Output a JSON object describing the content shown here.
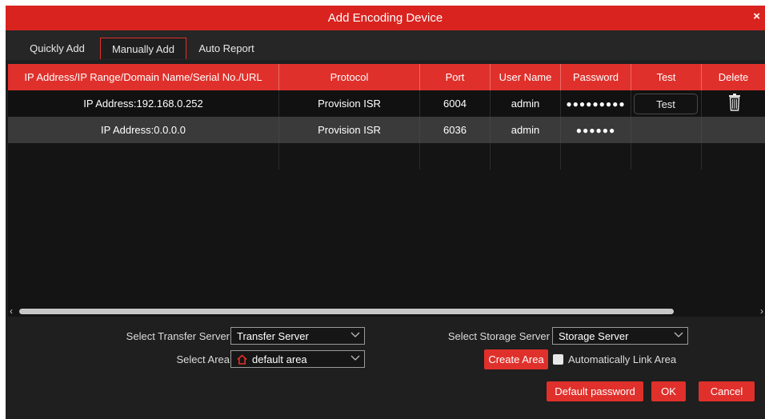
{
  "dialog": {
    "title": "Add Encoding Device",
    "close_label": "×"
  },
  "tabs": [
    {
      "label": "Quickly Add"
    },
    {
      "label": "Manually Add",
      "active": true
    },
    {
      "label": "Auto Report"
    }
  ],
  "table": {
    "columns": [
      "IP Address/IP Range/Domain Name/Serial No./URL",
      "Protocol",
      "Port",
      "User Name",
      "Password",
      "Test",
      "Delete"
    ],
    "rows": [
      {
        "address": "IP Address:192.168.0.252",
        "protocol": "Provision ISR",
        "port": "6004",
        "user": "admin",
        "password": "●●●●●●●●●",
        "test_label": "Test",
        "delete_icon": "trash-icon"
      },
      {
        "address": "IP Address:0.0.0.0",
        "protocol": "Provision ISR",
        "port": "6036",
        "user": "admin",
        "password": "●●●●●●"
      }
    ]
  },
  "scrollbar": {
    "left_arrow": "‹",
    "right_arrow": "›"
  },
  "form": {
    "transfer_server": {
      "label": "Select Transfer Server",
      "value": "Transfer Server"
    },
    "storage_server": {
      "label": "Select Storage Server",
      "value": "Storage Server"
    },
    "area": {
      "label": "Select Area",
      "value": "default area",
      "icon": "home-icon"
    },
    "create_area_label": "Create Area",
    "auto_link_label": "Automatically Link Area"
  },
  "footer": {
    "default_password_label": "Default password",
    "ok_label": "OK",
    "cancel_label": "Cancel"
  },
  "colors": {
    "accent": "#e0302b",
    "titlebar": "#d9231f",
    "background": "#1f1f1f",
    "table_bg": "#141414"
  }
}
